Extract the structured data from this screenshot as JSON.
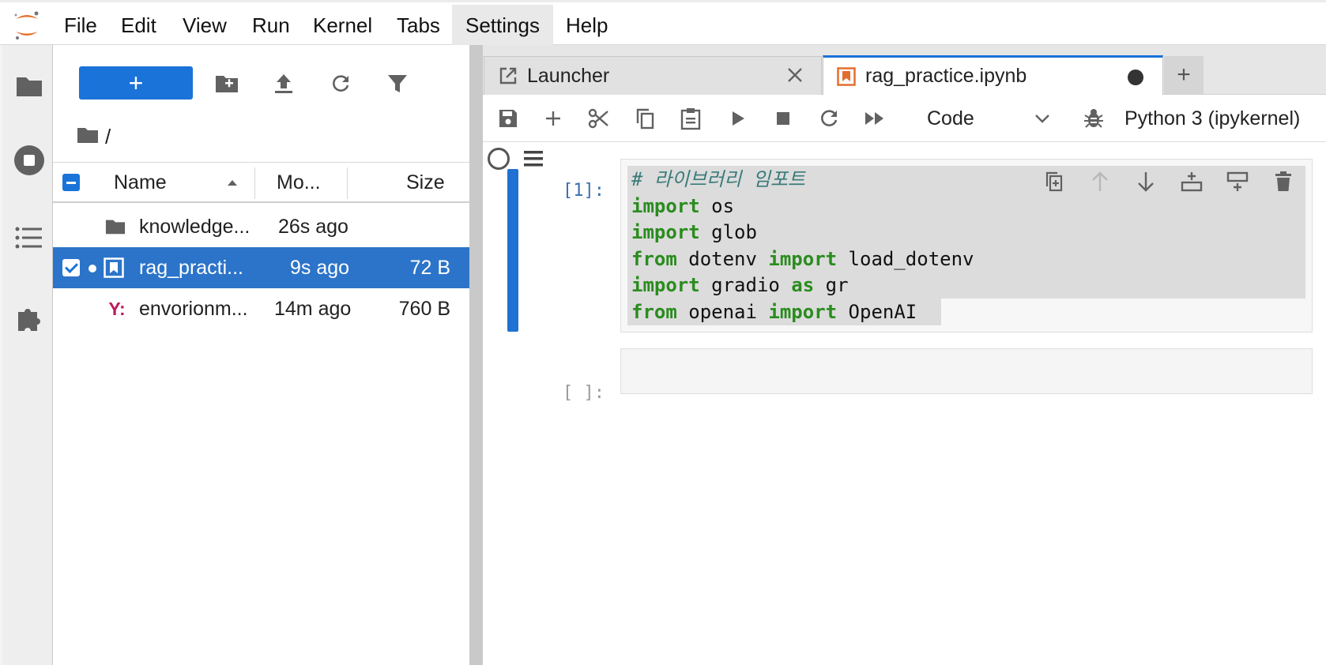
{
  "menu": {
    "items": [
      "File",
      "Edit",
      "View",
      "Run",
      "Kernel",
      "Tabs",
      "Settings",
      "Help"
    ],
    "active": "Settings"
  },
  "filebrowser": {
    "new_label": "+",
    "breadcrumb": "/",
    "columns": {
      "name": "Name",
      "modified": "Mo...",
      "size": "Size"
    },
    "rows": [
      {
        "icon": "folder-icon",
        "name": "knowledge...",
        "modified": "26s ago",
        "size": "",
        "selected": false
      },
      {
        "icon": "notebook-icon",
        "name": "rag_practi...",
        "modified": "9s ago",
        "size": "72 B",
        "selected": true
      },
      {
        "icon": "yaml-icon",
        "name": "envorionm...",
        "modified": "14m ago",
        "size": "760 B",
        "selected": false
      }
    ],
    "yaml_glyph": "Y:"
  },
  "tabs": [
    {
      "label": "Launcher",
      "icon": "launcher-icon",
      "active": false
    },
    {
      "label": "rag_practice.ipynb",
      "icon": "notebook-icon",
      "active": true
    }
  ],
  "tab_add": "+",
  "notebook": {
    "cell_type": "Code",
    "kernel": "Python 3 (ipykernel)",
    "cells": [
      {
        "prompt": "[1]:",
        "lines": [
          "# 라이브러리 임포트",
          "import os",
          "import glob",
          "from dotenv import load_dotenv",
          "import gradio as gr",
          "from openai import OpenAI"
        ]
      },
      {
        "prompt": "[ ]:",
        "lines": []
      }
    ]
  },
  "colors": {
    "accent": "#1a73d9",
    "keyword": "#2a8c1e",
    "comment": "#3a7a7a",
    "prompt_active": "#3a6fb0",
    "prompt_inactive": "#9a9a9a"
  }
}
